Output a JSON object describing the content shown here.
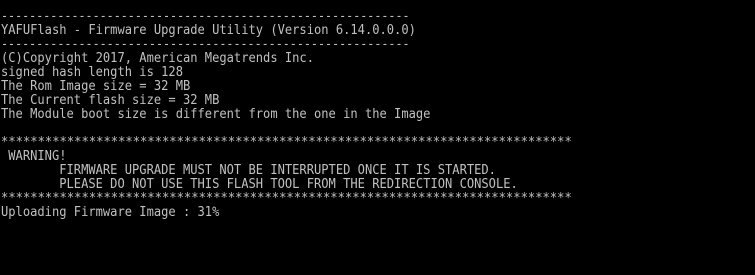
{
  "colors": {
    "background": "#000000",
    "foreground": "#c0c0c0"
  },
  "console": {
    "separator_top": "----------------------------------------------------------",
    "title": "YAFUFlash - Firmware Upgrade Utility (Version 6.14.0.0.0)",
    "separator_bottom": "----------------------------------------------------------",
    "copyright": "(C)Copyright 2017, American Megatrends Inc.",
    "hash_length": "signed hash length is 128",
    "rom_image_size": "The Rom Image size = 32 MB",
    "current_flash_size": "The Current flash size = 32 MB",
    "module_boot_size": "The Module boot size is different from the one in the Image",
    "stars_top": "******************************************************************************",
    "warning_heading": " WARNING!",
    "warning_line_1": "        FIRMWARE UPGRADE MUST NOT BE INTERRUPTED ONCE IT IS STARTED.",
    "warning_line_2": "        PLEASE DO NOT USE THIS FLASH TOOL FROM THE REDIRECTION CONSOLE.",
    "stars_bottom": "******************************************************************************",
    "upload_status": "Uploading Firmware Image : 31%"
  },
  "upload_progress_percent": 31
}
